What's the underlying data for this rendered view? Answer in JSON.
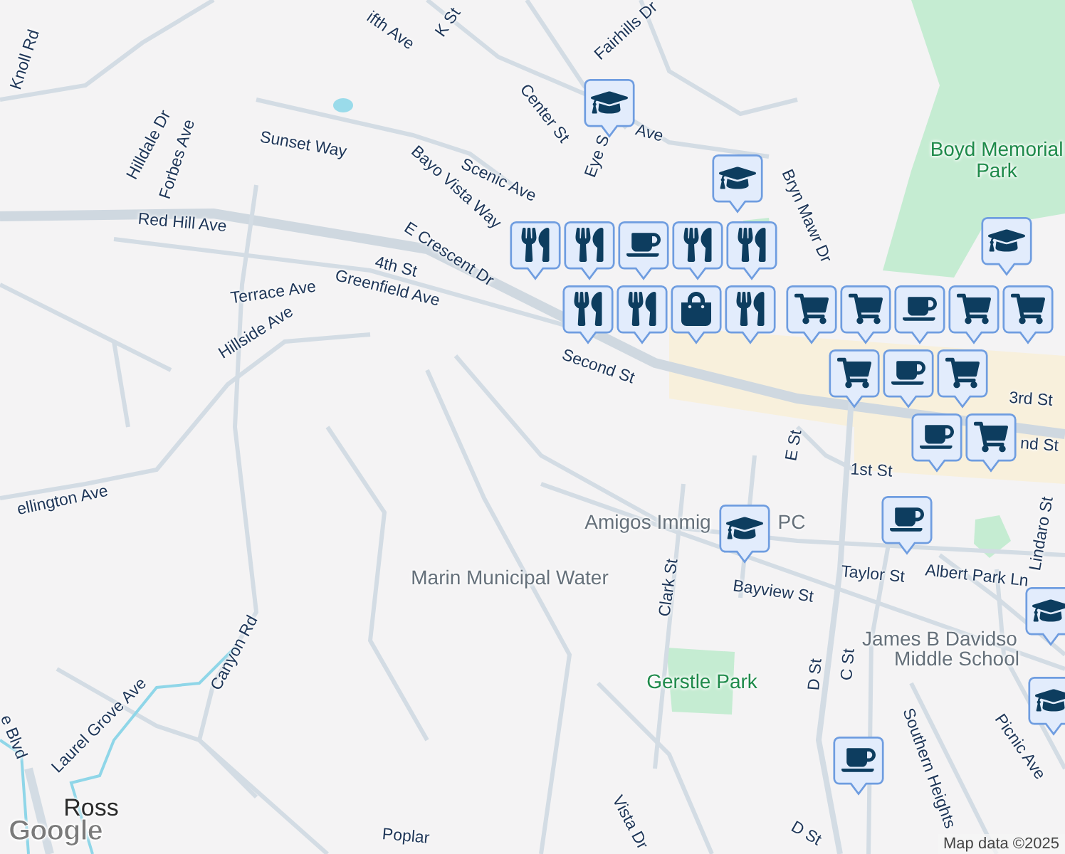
{
  "map": {
    "labels": [
      {
        "text": "Knoll Rd",
        "kind": "street"
      },
      {
        "text": "Hilldale Dr",
        "kind": "street"
      },
      {
        "text": "Forbes Ave",
        "kind": "street"
      },
      {
        "text": "Sunset Way",
        "kind": "street"
      },
      {
        "text": "Scenic Ave",
        "kind": "street"
      },
      {
        "text": "Bayo Vista Way",
        "kind": "street"
      },
      {
        "text": "Red Hill Ave",
        "kind": "street"
      },
      {
        "text": "E Crescent Dr",
        "kind": "street"
      },
      {
        "text": "4th St",
        "kind": "street"
      },
      {
        "text": "Greenfield Ave",
        "kind": "street"
      },
      {
        "text": "Terrace Ave",
        "kind": "street"
      },
      {
        "text": "Hillside Ave",
        "kind": "street"
      },
      {
        "text": "Center St",
        "kind": "street"
      },
      {
        "text": "K St",
        "kind": "street"
      },
      {
        "text": "Fairhills Dr",
        "kind": "street"
      },
      {
        "text": "Bryn Mawr Dr",
        "kind": "street"
      },
      {
        "text": "Boyd Memorial Park",
        "kind": "park"
      },
      {
        "text": "Second St",
        "kind": "street"
      },
      {
        "text": "3rd St",
        "kind": "street"
      },
      {
        "text": "nd St",
        "kind": "street"
      },
      {
        "text": "1st St",
        "kind": "street"
      },
      {
        "text": "E St",
        "kind": "street"
      },
      {
        "text": "Amigos Immig",
        "kind": "poi"
      },
      {
        "text": "PC",
        "kind": "poi"
      },
      {
        "text": "Marin Municipal Water",
        "kind": "poi"
      },
      {
        "text": "Clark St",
        "kind": "street"
      },
      {
        "text": "Bayview St",
        "kind": "street"
      },
      {
        "text": "Taylor St",
        "kind": "street"
      },
      {
        "text": "Albert Park Ln",
        "kind": "street"
      },
      {
        "text": "Lindaro St",
        "kind": "street"
      },
      {
        "text": "D St",
        "kind": "street"
      },
      {
        "text": "C St",
        "kind": "street"
      },
      {
        "text": "James B Davidso",
        "kind": "poi"
      },
      {
        "text": "Middle School",
        "kind": "poi"
      },
      {
        "text": "Gerstle Park",
        "kind": "park"
      },
      {
        "text": "Southern Heights",
        "kind": "street"
      },
      {
        "text": "Picnic Ave",
        "kind": "street"
      },
      {
        "text": "ellington Ave",
        "kind": "street"
      },
      {
        "text": "Canyon Rd",
        "kind": "street"
      },
      {
        "text": "Laurel Grove Ave",
        "kind": "street"
      },
      {
        "text": "Ross",
        "kind": "town"
      },
      {
        "text": "Vista Dr",
        "kind": "street"
      },
      {
        "text": "Poplar",
        "kind": "street"
      },
      {
        "text": "Eye S",
        "kind": "street"
      },
      {
        "text": "Ave",
        "kind": "street"
      },
      {
        "text": "ifth Ave",
        "kind": "street"
      },
      {
        "text": "D St",
        "kind": "street"
      },
      {
        "text": "e Blvd",
        "kind": "street"
      }
    ],
    "markers": [
      {
        "kind": "school"
      },
      {
        "kind": "school"
      },
      {
        "kind": "school"
      },
      {
        "kind": "school"
      },
      {
        "kind": "school"
      },
      {
        "kind": "school"
      },
      {
        "kind": "restaurant"
      },
      {
        "kind": "restaurant"
      },
      {
        "kind": "cafe"
      },
      {
        "kind": "restaurant"
      },
      {
        "kind": "restaurant"
      },
      {
        "kind": "restaurant"
      },
      {
        "kind": "restaurant"
      },
      {
        "kind": "shopping"
      },
      {
        "kind": "restaurant"
      },
      {
        "kind": "grocery"
      },
      {
        "kind": "grocery"
      },
      {
        "kind": "cafe"
      },
      {
        "kind": "grocery"
      },
      {
        "kind": "grocery"
      },
      {
        "kind": "grocery"
      },
      {
        "kind": "cafe"
      },
      {
        "kind": "grocery"
      },
      {
        "kind": "cafe"
      },
      {
        "kind": "grocery"
      },
      {
        "kind": "cafe"
      },
      {
        "kind": "cafe"
      }
    ],
    "logo": "Google",
    "attribution": "Map data ©2025"
  }
}
